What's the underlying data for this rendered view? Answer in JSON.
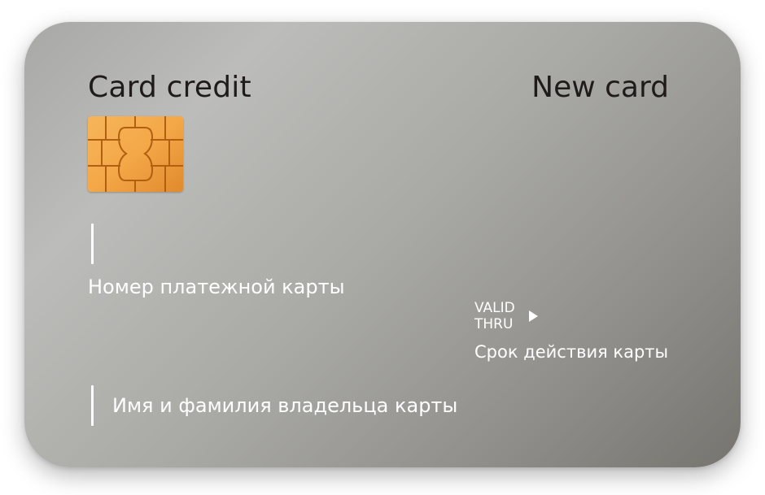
{
  "card": {
    "title": "Card credit",
    "brand": "New card",
    "number_field": {
      "value": "",
      "label": "Номер платежной карты"
    },
    "expiry_field": {
      "valid_thru_line1": "VALID",
      "valid_thru_line2": "THRU",
      "value": "",
      "label": "Срок действия карты"
    },
    "name_field": {
      "value": "",
      "placeholder": "Имя и фамилия владельца карты"
    }
  },
  "colors": {
    "card_light": "#bcbcba",
    "card_dark": "#76746f",
    "text_dark": "#1f1b1b",
    "text_light": "#ffffff",
    "chip_gold": "#f0a848"
  },
  "icons": {
    "chip": "emv-chip-icon",
    "arrow": "triangle-right-icon"
  }
}
